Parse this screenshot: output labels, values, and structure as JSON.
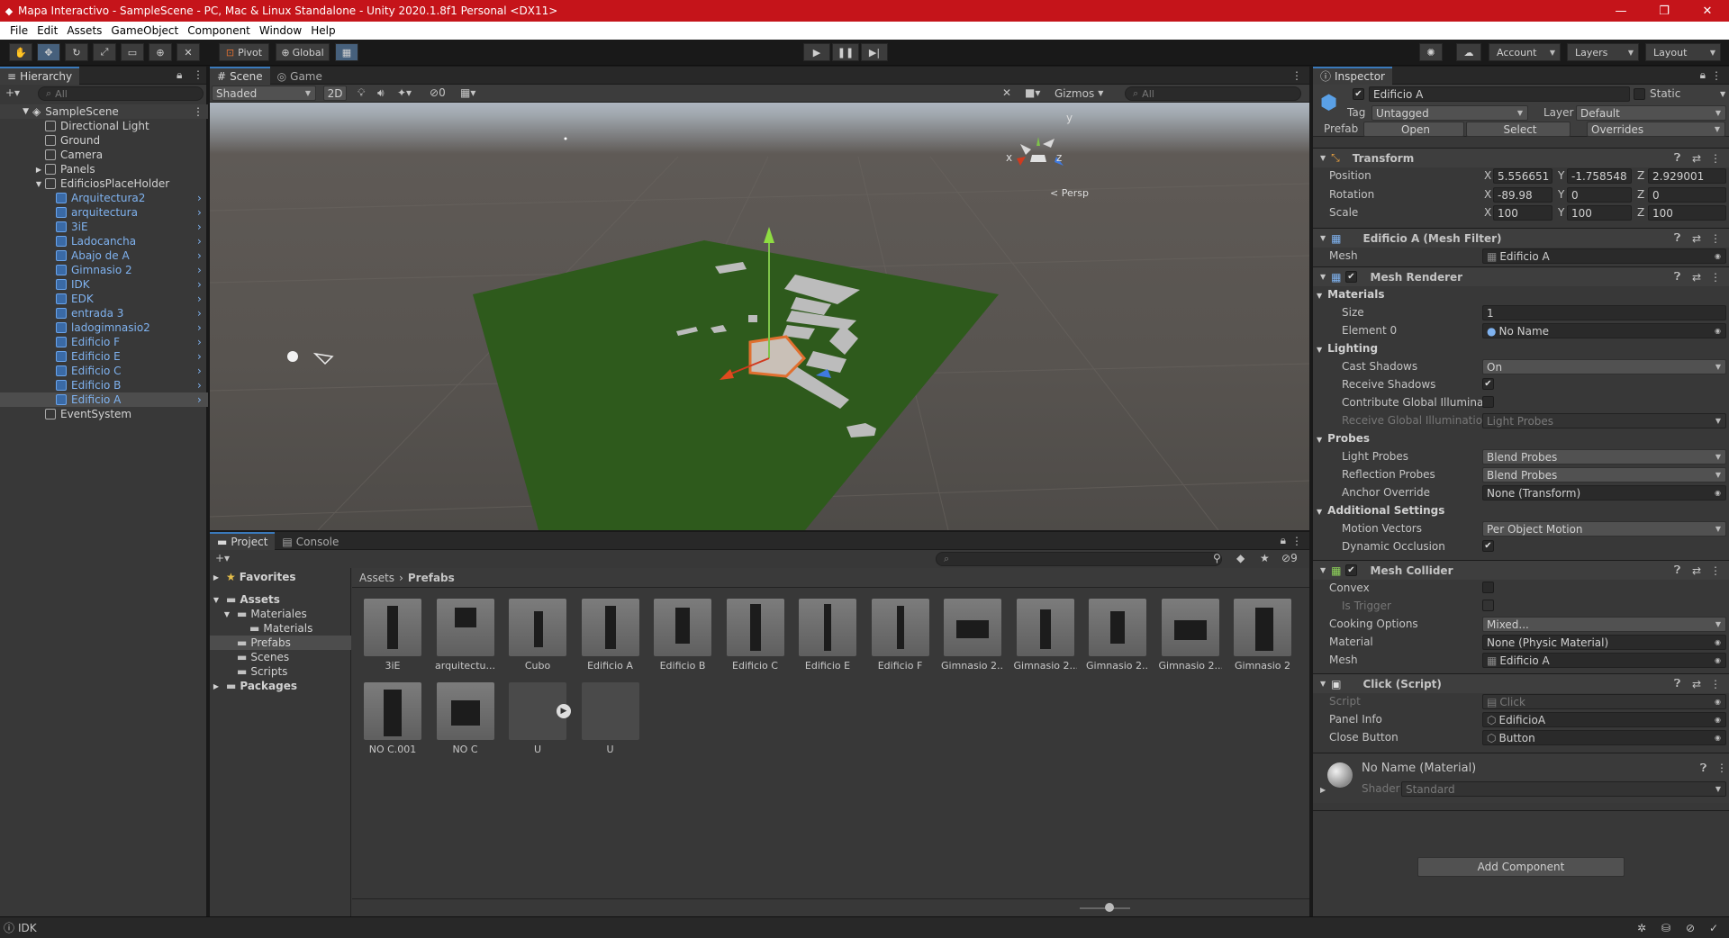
{
  "window": {
    "title": "Mapa Interactivo - SampleScene - PC, Mac & Linux Standalone - Unity 2020.1.8f1 Personal <DX11>"
  },
  "menu": [
    "File",
    "Edit",
    "Assets",
    "GameObject",
    "Component",
    "Window",
    "Help"
  ],
  "toolbar": {
    "pivot": "Pivot",
    "global": "Global",
    "account": "Account",
    "layers": "Layers",
    "layout": "Layout"
  },
  "hierarchy": {
    "tab": "Hierarchy",
    "search_placeholder": "All",
    "scene": "SampleScene",
    "items": [
      {
        "label": "Directional Light",
        "prefab": false
      },
      {
        "label": "Ground",
        "prefab": false
      },
      {
        "label": "Camera",
        "prefab": false
      },
      {
        "label": "Panels",
        "prefab": false
      },
      {
        "label": "EdificiosPlaceHolder",
        "prefab": false
      },
      {
        "label": "Arquitectura2",
        "prefab": true
      },
      {
        "label": "arquitectura",
        "prefab": true
      },
      {
        "label": "3iE",
        "prefab": true
      },
      {
        "label": "Ladocancha",
        "prefab": true
      },
      {
        "label": "Abajo de A",
        "prefab": true
      },
      {
        "label": "Gimnasio 2",
        "prefab": true
      },
      {
        "label": "IDK",
        "prefab": true
      },
      {
        "label": "EDK",
        "prefab": true
      },
      {
        "label": "entrada 3",
        "prefab": true
      },
      {
        "label": "ladogimnasio2",
        "prefab": true
      },
      {
        "label": "Edificio F",
        "prefab": true
      },
      {
        "label": "Edificio E",
        "prefab": true
      },
      {
        "label": "Edificio C",
        "prefab": true
      },
      {
        "label": "Edificio B",
        "prefab": true
      },
      {
        "label": "Edificio A",
        "prefab": true
      },
      {
        "label": "EventSystem",
        "prefab": false
      }
    ]
  },
  "scene": {
    "tabs": [
      "Scene",
      "Game"
    ],
    "shading": "Shaded",
    "mode2d": "2D",
    "hidden_count": "0",
    "gizmos": "Gizmos",
    "search_placeholder": "All",
    "persp": "< Persp",
    "axis": {
      "x": "x",
      "y": "y",
      "z": "z"
    }
  },
  "project": {
    "tabs": [
      "Project",
      "Console"
    ],
    "favorites": "Favorites",
    "tree": [
      "Assets",
      "Materiales",
      "Materials",
      "Prefabs",
      "Scenes",
      "Scripts",
      "Packages"
    ],
    "breadcrumb": [
      "Assets",
      "Prefabs"
    ],
    "hidden_count": "9",
    "assets": [
      "3iE",
      "arquitectu...",
      "Cubo",
      "Edificio A",
      "Edificio B",
      "Edificio C",
      "Edificio E",
      "Edificio F",
      "Gimnasio 2...",
      "Gimnasio 2...",
      "Gimnasio 2...",
      "Gimnasio 2...",
      "Gimnasio 2",
      "NO C.001",
      "NO C",
      "U",
      "U"
    ]
  },
  "inspector": {
    "tab": "Inspector",
    "object_name": "Edificio A",
    "static": "Static",
    "tag_label": "Tag",
    "tag": "Untagged",
    "layer_label": "Layer",
    "layer": "Default",
    "prefab_label": "Prefab",
    "prefab_open": "Open",
    "prefab_select": "Select",
    "prefab_overrides": "Overrides",
    "transform": {
      "title": "Transform",
      "position_label": "Position",
      "position": {
        "x": "5.556651",
        "y": "-1.758548",
        "z": "2.929001"
      },
      "rotation_label": "Rotation",
      "rotation": {
        "x": "-89.98",
        "y": "0",
        "z": "0"
      },
      "scale_label": "Scale",
      "scale": {
        "x": "100",
        "y": "100",
        "z": "100"
      }
    },
    "mesh_filter": {
      "title": "Edificio A (Mesh Filter)",
      "mesh_label": "Mesh",
      "mesh": "Edificio A"
    },
    "mesh_renderer": {
      "title": "Mesh Renderer",
      "materials": "Materials",
      "size_label": "Size",
      "size": "1",
      "element0_label": "Element 0",
      "element0": "No Name",
      "lighting": "Lighting",
      "cast_shadows_label": "Cast Shadows",
      "cast_shadows": "On",
      "receive_shadows_label": "Receive Shadows",
      "contribute_gi_label": "Contribute Global Illuminati",
      "receive_gi_label": "Receive Global Illumination",
      "receive_gi": "Light Probes",
      "probes": "Probes",
      "light_probes_label": "Light Probes",
      "light_probes": "Blend Probes",
      "reflection_probes_label": "Reflection Probes",
      "reflection_probes": "Blend Probes",
      "anchor_override_label": "Anchor Override",
      "anchor_override": "None (Transform)",
      "additional": "Additional Settings",
      "motion_vectors_label": "Motion Vectors",
      "motion_vectors": "Per Object Motion",
      "dynamic_occlusion_label": "Dynamic Occlusion"
    },
    "mesh_collider": {
      "title": "Mesh Collider",
      "convex_label": "Convex",
      "is_trigger_label": "Is Trigger",
      "cooking_label": "Cooking Options",
      "cooking": "Mixed...",
      "material_label": "Material",
      "material": "None (Physic Material)",
      "mesh_label": "Mesh",
      "mesh": "Edificio A"
    },
    "click_script": {
      "title": "Click (Script)",
      "script_label": "Script",
      "script": "Click",
      "panel_info_label": "Panel Info",
      "panel_info": "EdificioA",
      "close_button_label": "Close Button",
      "close_button": "Button"
    },
    "material": {
      "name": "No Name (Material)",
      "shader_label": "Shader",
      "shader": "Standard"
    },
    "add_component": "Add Component"
  },
  "status": {
    "text": "IDK"
  },
  "colors": {
    "title_bar": "#c5141a",
    "accent": "#3a79bb",
    "prefab_text": "#7fb2ef",
    "ground": "#2e5a1c"
  }
}
